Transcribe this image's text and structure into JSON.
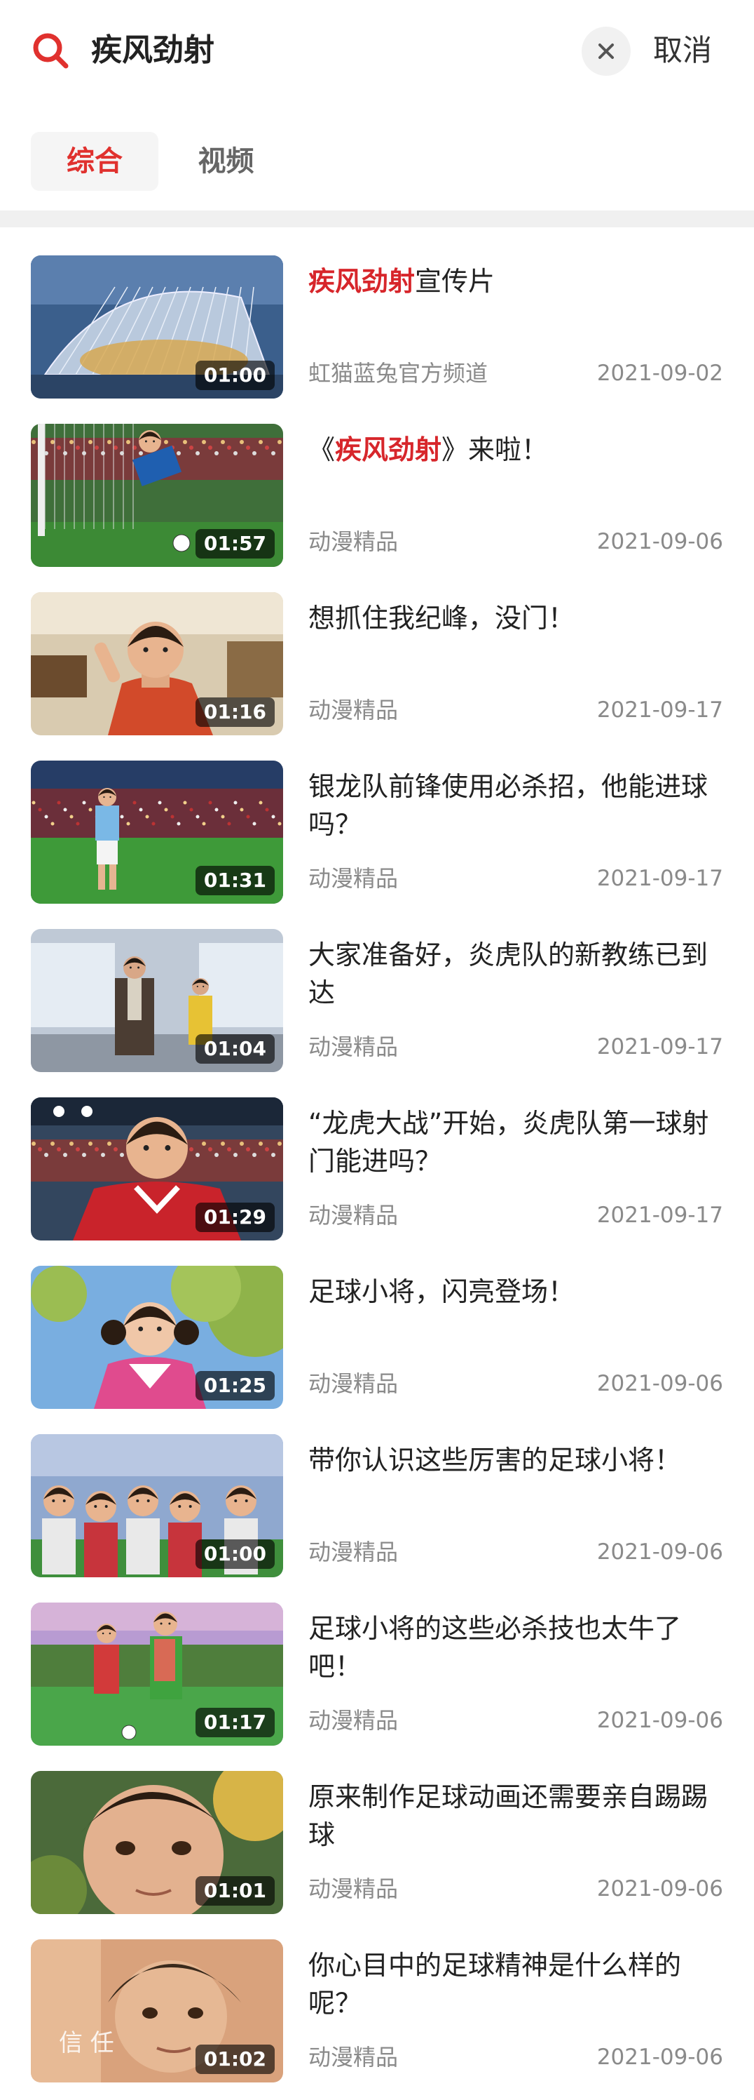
{
  "search": {
    "query": "疾风劲射",
    "cancel_label": "取消",
    "icon": "search-icon",
    "clear_icon": "close-icon",
    "accent": "#e0312e"
  },
  "tabs": [
    {
      "label": "综合",
      "active": true
    },
    {
      "label": "视频",
      "active": false
    }
  ],
  "results": [
    {
      "title_pre": "",
      "title_hl": "疾风劲射",
      "title_post": "宣传片",
      "channel": "虹猫蓝兔官方频道",
      "date": "2021-09-02",
      "duration": "01:00",
      "thumb": "stadium-aerial"
    },
    {
      "title_pre": "《",
      "title_hl": "疾风劲射",
      "title_post": "》来啦！",
      "channel": "动漫精品",
      "date": "2021-09-06",
      "duration": "01:57",
      "thumb": "goalkeeper-dive"
    },
    {
      "title_pre": "想抓住我纪峰，没门！",
      "title_hl": "",
      "title_post": "",
      "channel": "动漫精品",
      "date": "2021-09-17",
      "duration": "01:16",
      "thumb": "boy-in-mall"
    },
    {
      "title_pre": "银龙队前锋使用必杀招，他能进球吗？",
      "title_hl": "",
      "title_post": "",
      "channel": "动漫精品",
      "date": "2021-09-17",
      "duration": "01:31",
      "thumb": "player-on-pitch"
    },
    {
      "title_pre": "大家准备好，炎虎队的新教练已到达",
      "title_hl": "",
      "title_post": "",
      "channel": "动漫精品",
      "date": "2021-09-17",
      "duration": "01:04",
      "thumb": "coach-arrival"
    },
    {
      "title_pre": "“龙虎大战”开始，炎虎队第一球射门能进吗？",
      "title_hl": "",
      "title_post": "",
      "channel": "动漫精品",
      "date": "2021-09-17",
      "duration": "01:29",
      "thumb": "red-jersey-player"
    },
    {
      "title_pre": "足球小将，闪亮登场！",
      "title_hl": "",
      "title_post": "",
      "channel": "动漫精品",
      "date": "2021-09-06",
      "duration": "01:25",
      "thumb": "girl-pigtails"
    },
    {
      "title_pre": "带你认识这些厉害的足球小将！",
      "title_hl": "",
      "title_post": "",
      "channel": "动漫精品",
      "date": "2021-09-06",
      "duration": "01:00",
      "thumb": "team-group"
    },
    {
      "title_pre": "足球小将的这些必杀技也太牛了吧！",
      "title_hl": "",
      "title_post": "",
      "channel": "动漫精品",
      "date": "2021-09-06",
      "duration": "01:17",
      "thumb": "players-running"
    },
    {
      "title_pre": "原来制作足球动画还需要亲自踢踢球",
      "title_hl": "",
      "title_post": "",
      "channel": "动漫精品",
      "date": "2021-09-06",
      "duration": "01:01",
      "thumb": "boy-closeup"
    },
    {
      "title_pre": "你心目中的足球精神是什么样的呢？",
      "title_hl": "",
      "title_post": "",
      "channel": "动漫精品",
      "date": "2021-09-06",
      "duration": "01:02",
      "thumb": "boy-portrait",
      "watermark": "信 任"
    }
  ]
}
